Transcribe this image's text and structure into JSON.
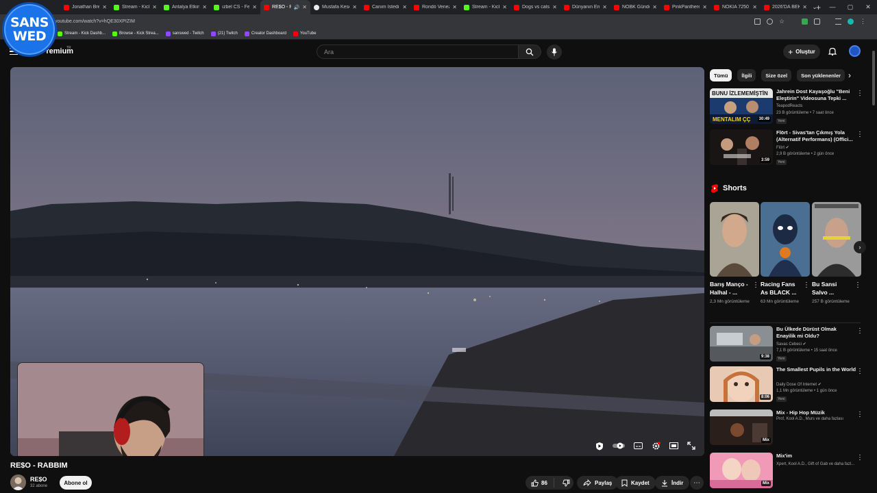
{
  "browser": {
    "tabs": [
      {
        "label": "Jonathan Bre",
        "color": "#ff0000"
      },
      {
        "label": "Stream - Kick",
        "color": "#53fc18"
      },
      {
        "label": "Antalya Etkin",
        "color": "#53fc18"
      },
      {
        "label": "ızbel CS - Fe",
        "color": "#53fc18"
      },
      {
        "label": "RE$O - RA",
        "color": "#ff0000",
        "active": true
      },
      {
        "label": "Mustafa Kese",
        "color": "#e8eaed"
      },
      {
        "label": "Canım İstedi",
        "color": "#ff0000"
      },
      {
        "label": "Rondò Venez",
        "color": "#ff0000"
      },
      {
        "label": "Stream - Kick",
        "color": "#53fc18"
      },
      {
        "label": "Dogs vs cats",
        "color": "#ff0000"
      },
      {
        "label": "Dünyanın En",
        "color": "#ff0000"
      },
      {
        "label": "NOBK Günde",
        "color": "#ff0000"
      },
      {
        "label": "PinkPanthere",
        "color": "#ff0000"
      },
      {
        "label": "NOKIA 7250",
        "color": "#ff0000"
      },
      {
        "label": "2026'DA BEK",
        "color": "#ff0000"
      }
    ],
    "url": "youtube.com/watch?v=hQE30XPIZIM",
    "bookmarks": [
      {
        "label": "Stream - Kick Dashb...",
        "color": "#53fc18"
      },
      {
        "label": "Browse - Kick Strea...",
        "color": "#53fc18"
      },
      {
        "label": "sanswed - Twitch",
        "color": "#9146ff"
      },
      {
        "label": "(21) Twitch",
        "color": "#9146ff"
      },
      {
        "label": "Creator Dashboard",
        "color": "#9146ff"
      },
      {
        "label": "YouTube",
        "color": "#ff0000"
      }
    ]
  },
  "logo": {
    "line1": "SANS",
    "line2": "WED"
  },
  "header": {
    "brand": "Premium",
    "brand_sup": "TR",
    "search_placeholder": "Ara",
    "create_label": "Oluştur"
  },
  "video": {
    "title": "RE$O - RABBIM",
    "channel": "RE$O",
    "subs": "32 abone",
    "subscribe_label": "Abone ol",
    "likes": "86",
    "share_label": "Paylaş",
    "save_label": "Kaydet",
    "download_label": "İndir"
  },
  "sidebar": {
    "chips": [
      "Tümü",
      "İlgili",
      "Size özel",
      "Son yüklenenler"
    ],
    "top_recs": [
      {
        "title": "Jahrein Dost Kayaşoğlu \"Beni Eleştirin\" Videosuna Tepki ...",
        "channel": "TeapodReacts",
        "meta": "23 B görüntüleme • 7 saat önce",
        "badge": "Yeni",
        "duration": "30:49",
        "thumb_text": "MENTALIM ÇÇ"
      },
      {
        "title": "Flört - Sivas'tan Çıkmış Yola (Alternatif Performans) (Offici...",
        "channel": "Flört ✔",
        "meta": "2,9 B görüntüleme • 2 gün önce",
        "badge": "Yeni",
        "duration": "3:59",
        "thumb_text": ""
      }
    ],
    "shorts_title": "Shorts",
    "shorts": [
      {
        "title": "Barış Manço - Halhal - ...",
        "views": "2,3 Mn görüntüleme"
      },
      {
        "title": "Racing Fans As BLACK ...",
        "views": "63 Mn görüntüleme"
      },
      {
        "title": "Bu Sansi Salvo ...",
        "views": "257 B görüntüleme"
      }
    ],
    "bottom_recs": [
      {
        "title": "Bu Ülkede Dürüst Olmak Enayilik mi Oldu?",
        "channel": "Savas Cebeci ✔",
        "meta": "7,1 B görüntüleme • 15 saat önce",
        "badge": "Yeni",
        "duration": "9:38"
      },
      {
        "title": "The Smallest Pupils in the World",
        "channel": "Daily Dose Of Internet ✔",
        "meta": "1,1 Mn görüntüleme • 1 gün önce",
        "badge": "Yeni",
        "duration": "8:06"
      },
      {
        "title": "Mix - Hip Hop Müzik",
        "channel": "Prof, Kool A.D., Murs ve daha fazlası",
        "meta": "",
        "badge": "",
        "duration": "Mix"
      },
      {
        "title": "Mix'im",
        "channel": "Xpert, Kool A.D., Gift of Gab ve daha fazl...",
        "meta": "",
        "badge": "",
        "duration": "Mix"
      }
    ]
  },
  "colors": {
    "background": "#0f0f0f",
    "accent": "#ff0000",
    "kick": "#53fc18",
    "twitch": "#9146ff"
  }
}
